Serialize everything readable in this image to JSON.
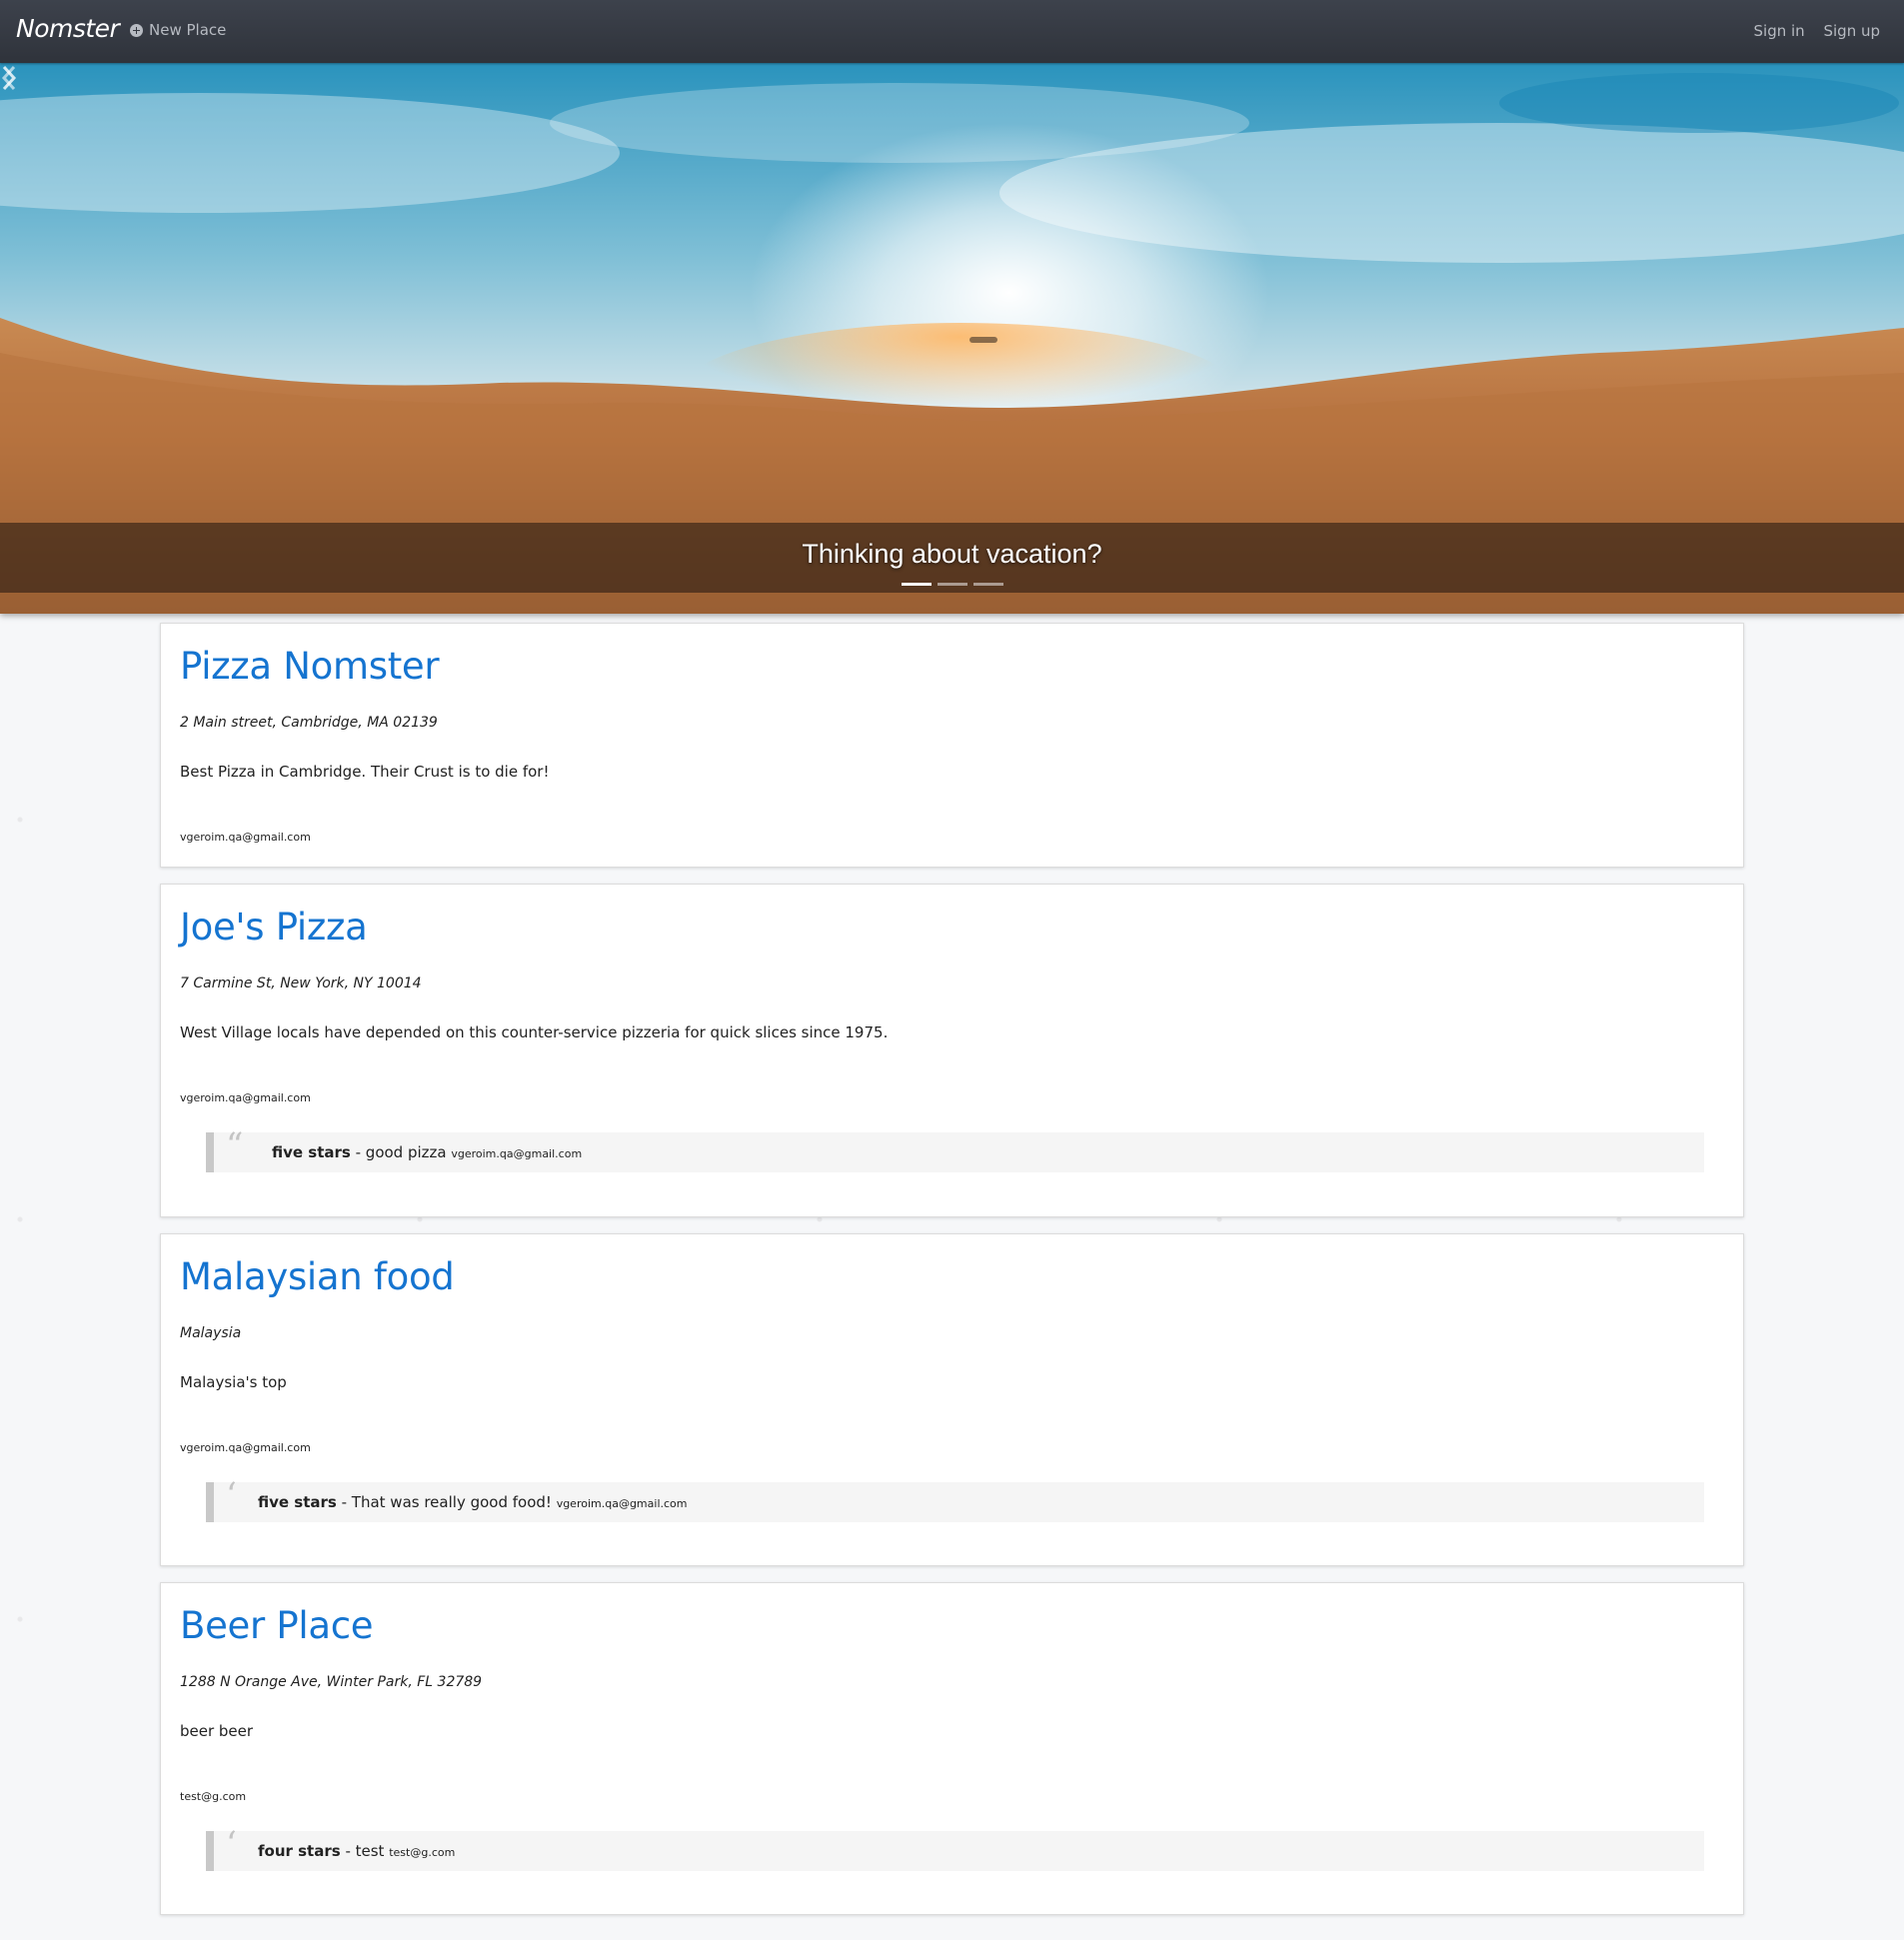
{
  "navbar": {
    "brand": "Nomster",
    "new_place_label": "New Place",
    "sign_in_label": "Sign in",
    "sign_up_label": "Sign up"
  },
  "hero": {
    "caption": "Thinking about vacation?",
    "active_slide": 1,
    "slide_count": 3
  },
  "places": [
    {
      "name": "Pizza Nomster",
      "address": "2 Main street, Cambridge, MA 02139",
      "description": "Best Pizza in Cambridge. Their Crust is to die for!",
      "email": "vgeroim.qa@gmail.com",
      "comments": []
    },
    {
      "name": "Joe's Pizza",
      "address": "7 Carmine St, New York, NY 10014",
      "description": "West Village locals have depended on this counter-service pizzeria for quick slices since 1975.",
      "email": "vgeroim.qa@gmail.com",
      "comments": [
        {
          "rating": "five stars",
          "text": " - good pizza ",
          "email": "vgeroim.qa@gmail.com"
        }
      ]
    },
    {
      "name": "Malaysian food",
      "address": "Malaysia",
      "description": "Malaysia's top",
      "email": "vgeroim.qa@gmail.com",
      "comments": [
        {
          "rating": "five stars",
          "text": " - That was really good food! ",
          "email": "vgeroim.qa@gmail.com"
        }
      ]
    },
    {
      "name": "Beer Place",
      "address": "1288 N Orange Ave, Winter Park, FL 32789",
      "description": "beer beer",
      "email": "test@g.com",
      "comments": [
        {
          "rating": "four stars",
          "text": " - test ",
          "email": "test@g.com"
        }
      ]
    }
  ],
  "colors": {
    "navbar_bg": "#353942",
    "link_blue": "#1574d0",
    "page_bg": "#f6f7f9"
  }
}
